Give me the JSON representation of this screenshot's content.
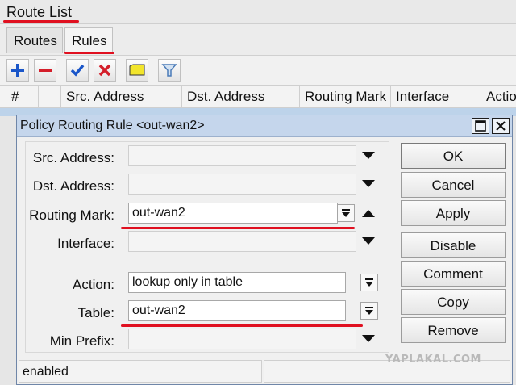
{
  "window": {
    "title": "Route List"
  },
  "tabs": [
    {
      "label": "Routes"
    },
    {
      "label": "Rules"
    }
  ],
  "toolbar": {
    "buttons": [
      {
        "icon": "plus-icon",
        "color": "#1a56c9"
      },
      {
        "icon": "minus-icon",
        "color": "#d41e2a"
      },
      {
        "icon": "check-icon",
        "color": "#1a56c9"
      },
      {
        "icon": "cross-icon",
        "color": "#d41e2a"
      },
      {
        "icon": "comment-icon",
        "color": "#f2e52c"
      },
      {
        "icon": "filter-icon",
        "color": "#4a7bb8"
      }
    ]
  },
  "table": {
    "headers": [
      "#",
      "",
      "Src. Address",
      "Dst. Address",
      "Routing Mark",
      "Interface",
      "Action"
    ]
  },
  "dialog": {
    "title": "Policy Routing Rule <out-wan2>",
    "fields": {
      "src_address": {
        "label": "Src. Address:",
        "value": ""
      },
      "dst_address": {
        "label": "Dst. Address:",
        "value": ""
      },
      "routing_mark": {
        "label": "Routing Mark:",
        "value": "out-wan2"
      },
      "interface": {
        "label": "Interface:",
        "value": ""
      },
      "action": {
        "label": "Action:",
        "value": "lookup only in table"
      },
      "table": {
        "label": "Table:",
        "value": "out-wan2"
      },
      "min_prefix": {
        "label": "Min Prefix:",
        "value": ""
      }
    },
    "buttons": {
      "ok": "OK",
      "cancel": "Cancel",
      "apply": "Apply",
      "disable": "Disable",
      "comment": "Comment",
      "copy": "Copy",
      "remove": "Remove"
    },
    "status": "enabled"
  },
  "watermark": "YAPLAKAL.COM",
  "colors": {
    "annotation_red": "#e01020",
    "dialog_title_bg": "#c5d6ec",
    "selected_row": "#bdd3ea"
  }
}
